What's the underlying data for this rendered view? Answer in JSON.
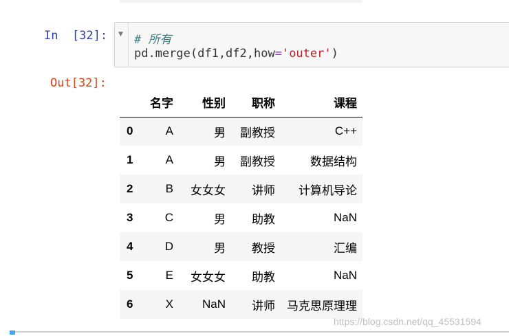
{
  "input_cell": {
    "prompt": "In  [32]:",
    "fold_marker": "▼",
    "code": {
      "comment": "# 所有",
      "line2_prefix": "pd.merge(df1,df2,how",
      "line2_op": "=",
      "line2_str": "'outer'",
      "line2_suffix": ")"
    }
  },
  "output_cell": {
    "prompt": "Out[32]:",
    "table": {
      "columns": [
        "名字",
        "性别",
        "职称",
        "课程"
      ],
      "rows": [
        {
          "index": "0",
          "values": [
            "A",
            "男",
            "副教授",
            "C++"
          ]
        },
        {
          "index": "1",
          "values": [
            "A",
            "男",
            "副教授",
            "数据结构"
          ]
        },
        {
          "index": "2",
          "values": [
            "B",
            "女女女",
            "讲师",
            "计算机导论"
          ]
        },
        {
          "index": "3",
          "values": [
            "C",
            "男",
            "助教",
            "NaN"
          ]
        },
        {
          "index": "4",
          "values": [
            "D",
            "男",
            "教授",
            "汇编"
          ]
        },
        {
          "index": "5",
          "values": [
            "E",
            "女女女",
            "助教",
            "NaN"
          ]
        },
        {
          "index": "6",
          "values": [
            "X",
            "NaN",
            "讲师",
            "马克思原理理"
          ]
        }
      ]
    }
  },
  "watermark": "https://blog.csdn.net/qq_45531594",
  "colors": {
    "in_prompt": "#303f9f",
    "out_prompt": "#d84315",
    "comment": "#408080",
    "string": "#ba2121",
    "operator": "#aa22ff"
  }
}
